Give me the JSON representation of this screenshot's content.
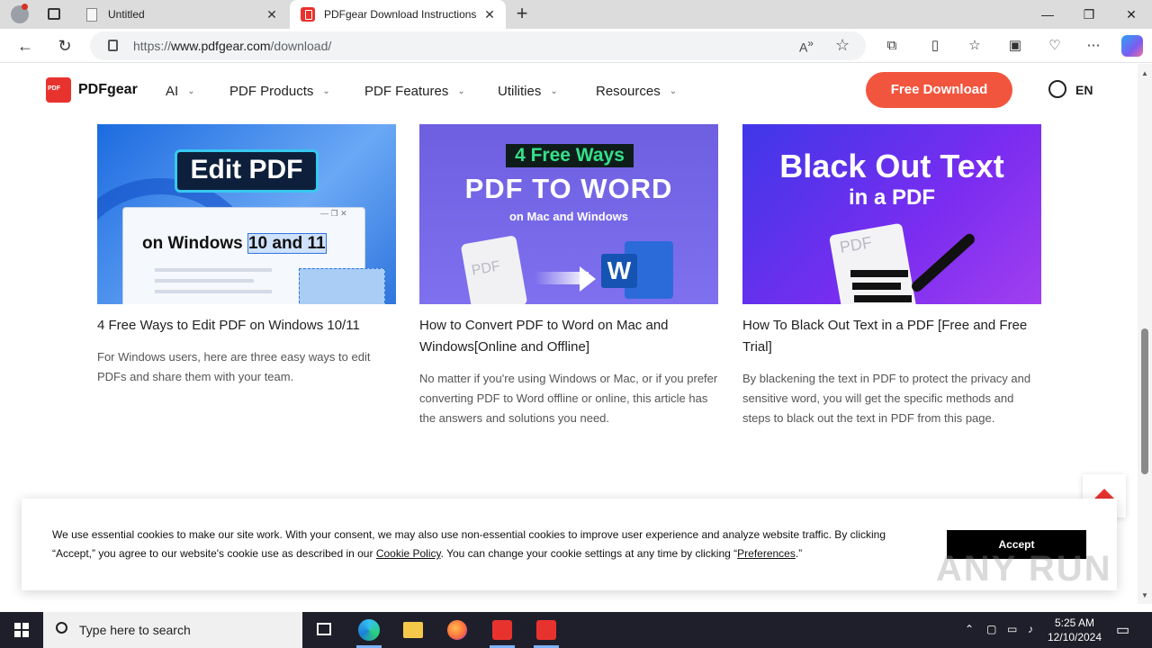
{
  "browser": {
    "tabs": [
      {
        "title": "Untitled"
      },
      {
        "title": "PDFgear Download Instructions"
      }
    ],
    "url_prefix": "https://",
    "url_host": "www.pdfgear.com",
    "url_path": "/download/"
  },
  "site": {
    "logo": "PDFgear",
    "menu": [
      "AI",
      "PDF Products",
      "PDF Features",
      "Utilities",
      "Resources"
    ],
    "cta": "Free Download",
    "lang": "EN"
  },
  "cards": [
    {
      "thumb_heading": "Edit PDF",
      "thumb_sub_a": "on Windows ",
      "thumb_sub_b": "10 and 11",
      "title": "4 Free Ways to Edit PDF on Windows 10/11",
      "desc": "For Windows users, here are three easy ways to edit PDFs and share them with your team."
    },
    {
      "thumb_badge": "4 Free Ways",
      "thumb_heading": "PDF TO WORD",
      "thumb_sub": "on Mac and Windows",
      "thumb_pdf": "PDF",
      "thumb_w": "W",
      "title": "How to Convert PDF to Word on Mac and Windows[Online and Offline]",
      "desc": "No matter if you're using Windows or Mac, or if you prefer converting PDF to Word offline or online, this article has the answers and solutions you need."
    },
    {
      "thumb_heading": "Black Out Text",
      "thumb_sub": "in a PDF",
      "thumb_pdf": "PDF",
      "title": "How To Black Out Text in a PDF [Free and Free Trial]",
      "desc": "By blackening the text in PDF to protect the privacy and sensitive word, you will get the specific methods and steps to black out the text in PDF from this page."
    }
  ],
  "cookie": {
    "text_a": "We use essential cookies to make our site work. With your consent, we may also use non-essential cookies to improve user experience and analyze website traffic. By clicking “Accept,” you agree to our website's cookie use as described in our ",
    "policy_link": "Cookie Policy",
    "text_b": ". You can change your cookie settings at any time by clicking “",
    "prefs_link": "Preferences",
    "text_c": ".”",
    "accept": "Accept"
  },
  "watermark": "ANY RUN",
  "taskbar": {
    "search_placeholder": "Type here to search",
    "time": "5:25 AM",
    "date": "12/10/2024"
  },
  "colors": {
    "brand_red": "#e8322e",
    "cta": "#f2553e",
    "taskbar": "#1f1f2b"
  }
}
